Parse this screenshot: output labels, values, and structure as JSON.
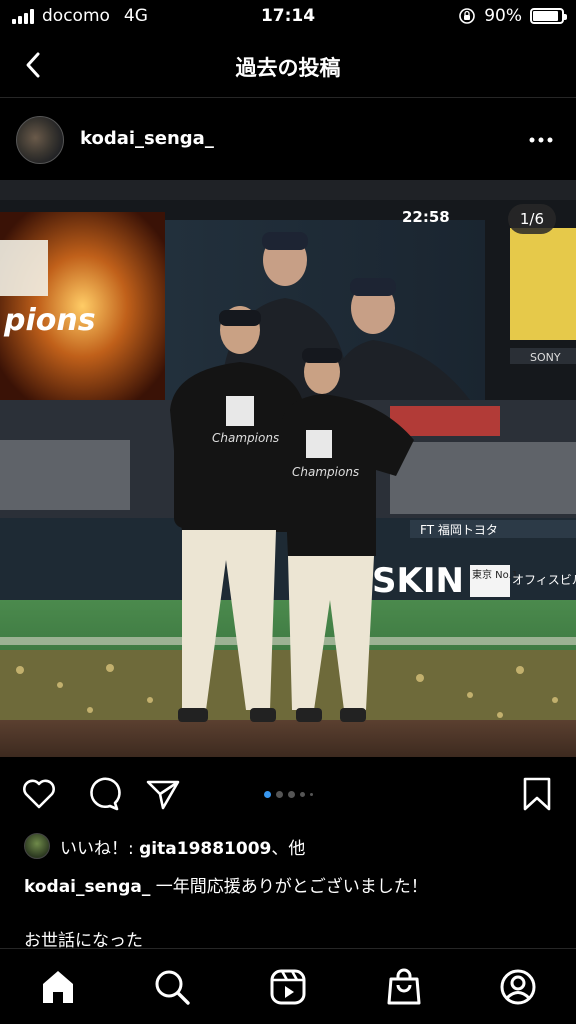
{
  "status_bar": {
    "carrier": "docomo",
    "network": "4G",
    "time": "17:14",
    "battery": "90%",
    "battery_level": 0.9
  },
  "header": {
    "title": "過去の投稿",
    "back_icon": "chevron-left-icon"
  },
  "post": {
    "username": "kodai_senga_",
    "more_icon": "ellipsis-icon",
    "image_counter": "1/6",
    "scoreboard_time": "22:58",
    "banner_right": "SKIN",
    "banner_tokyo": "東京 No.1",
    "banner_office": "オフィスビル 住友不",
    "banner_ft": "FT 福岡トヨタ",
    "banner_sony": "SONY",
    "shirt_text": "Champions",
    "carousel_pages": 5,
    "carousel_active": 0
  },
  "actions": {
    "like_icon": "heart-icon",
    "comment_icon": "comment-icon",
    "share_icon": "send-icon",
    "save_icon": "bookmark-icon"
  },
  "likes": {
    "prefix": "いいね！: ",
    "user": "gita19881009",
    "suffix": "、他"
  },
  "caption": {
    "username": "kodai_senga_",
    "text": " 一年間応援ありがとございました！",
    "more_line": "お世話になった"
  },
  "nav": {
    "home_icon": "home-icon",
    "search_icon": "search-icon",
    "reels_icon": "reels-icon",
    "shop_icon": "shopping-bag-icon",
    "profile_icon": "profile-icon"
  }
}
